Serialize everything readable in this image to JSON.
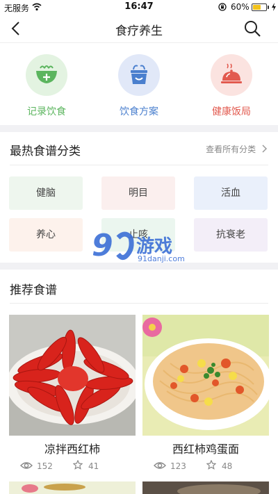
{
  "status_bar": {
    "carrier": "无服务",
    "time": "16:47",
    "battery": "60%",
    "battery_level": 0.6
  },
  "nav": {
    "title": "食疗养生"
  },
  "features": [
    {
      "label": "记录饮食",
      "icon": "bowl-plus-icon",
      "color": "#5bb55e",
      "bg": "#e3f3e1"
    },
    {
      "label": "饮食方案",
      "icon": "basket-icon",
      "color": "#4a7fce",
      "bg": "#e1e8f8"
    },
    {
      "label": "健康饭局",
      "icon": "dining-cloche-icon",
      "color": "#e25a4f",
      "bg": "#fbe3e0"
    }
  ],
  "categories_section": {
    "title": "最热食谱分类",
    "see_all": "查看所有分类",
    "items": [
      {
        "label": "健脑",
        "bg": "#eef6ee"
      },
      {
        "label": "明目",
        "bg": "#fbefee"
      },
      {
        "label": "活血",
        "bg": "#eaf0fb"
      },
      {
        "label": "养心",
        "bg": "#fdf2ec"
      },
      {
        "label": "止咳",
        "bg": "#ebf6ef"
      },
      {
        "label": "抗衰老",
        "bg": "#f3eef8"
      }
    ]
  },
  "recommend_section": {
    "title": "推荐食谱",
    "recipes": [
      {
        "name": "凉拌西红柿",
        "views": "152",
        "favorites": "41"
      },
      {
        "name": "西红柿鸡蛋面",
        "views": "123",
        "favorites": "48"
      }
    ]
  },
  "watermark": {
    "brand": "游戏",
    "number": "9",
    "site": "91danji.com"
  }
}
